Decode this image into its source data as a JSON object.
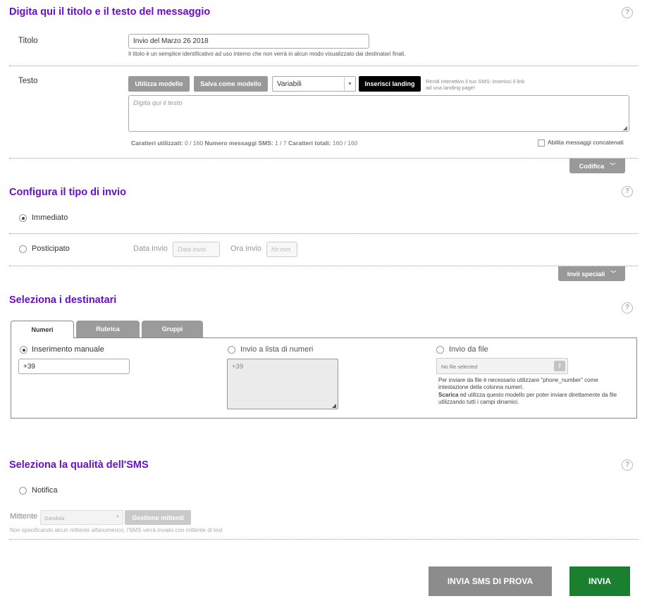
{
  "message": {
    "title": "Digita qui il titolo e il testo del messaggio",
    "help": "?",
    "titolo_label": "Titolo",
    "titolo_value": "Invio del Marzo 26 2018",
    "titolo_hint": "Il titolo è un semplice identificativo ad uso interno che non verrà in alcun modo visualizzato dai destinatari finali.",
    "testo_label": "Testo",
    "utilizza_modello": "Utilizza modello",
    "salva_modello": "Salva come modello",
    "variabili": "Variabili",
    "inserisci_landing": "Inserisci landing",
    "landing_hint": "Rendi interattivo il tuo SMS: inserisci il link ad una landing page!",
    "textarea_placeholder": "Digita qui il testo",
    "char_label": "Caratteri utilizzati:",
    "char_value": "0 / 160",
    "msg_label": "Numero messaggi SMS:",
    "msg_value": "1 / 7",
    "total_label": "Caratteri totali:",
    "total_value": "160 / 160",
    "concat_label": "Abilita messaggi concatenati",
    "codifica": "Codifica"
  },
  "send_type": {
    "title": "Configura il tipo di invio",
    "help": "?",
    "immediato": "Immediato",
    "posticipato": "Posticipato",
    "data_label": "Data invio",
    "data_placeholder": "Data invio",
    "ora_label": "Ora invio",
    "ora_placeholder": "hh:mm",
    "invii_speciali": "Invii speciali"
  },
  "recipients": {
    "title": "Seleziona i destinatari",
    "help": "?",
    "tabs": [
      "Numeri",
      "Rubrica",
      "Gruppi"
    ],
    "manual_label": "Inserimento manuale",
    "manual_value": "+39",
    "list_label": "Invio a lista di numeri",
    "list_value": "+39",
    "file_label": "Invio da file",
    "file_placeholder": "No file selected",
    "file_hint_1": "Per inviare da file è necessario utilizzare \"phone_number\" come intestazione della colonna numeri.",
    "file_hint_2_bold": "Scarica",
    "file_hint_2": "ed utilizza questo modello per poter inviare direttamente da file utilizzando tutti i campi dinamici."
  },
  "quality": {
    "title": "Seleziona la qualità dell'SMS",
    "help": "?",
    "notifica": "Notifica",
    "mittente_label": "Mittente",
    "mittente_value": "Gandola",
    "gestione_mittenti": "Gestione mittenti",
    "mittente_hint": "Non specificando alcun mittente alfanumerico, l'SMS verrà inviato con mittente di test"
  },
  "actions": {
    "test": "INVIA SMS DI PROVA",
    "send": "INVIA"
  },
  "colors": {
    "accent": "#6a0dcc",
    "send_green": "#1a7f2e",
    "test_gray": "#8c8c8c"
  }
}
